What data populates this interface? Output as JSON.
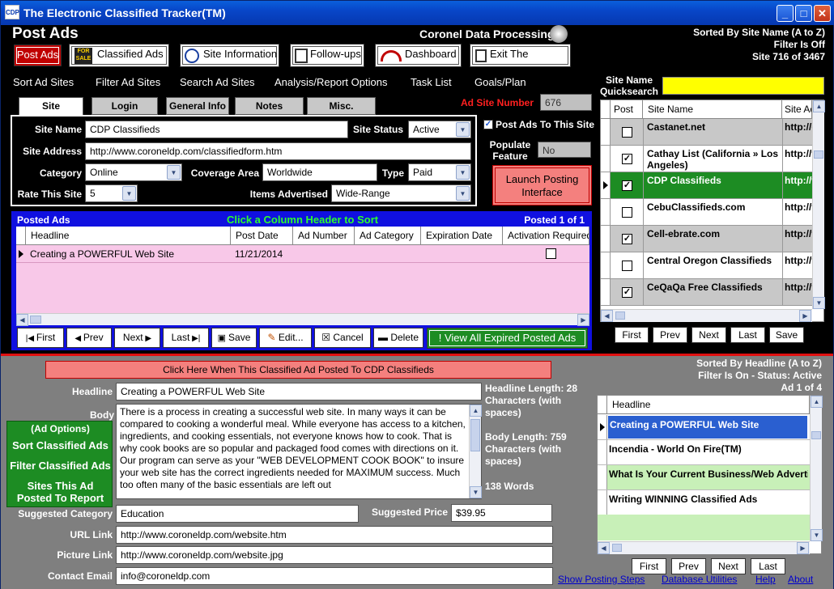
{
  "window": {
    "title": "The Electronic Classified Tracker(TM)",
    "icon_text": "CDP"
  },
  "header": {
    "title": "Post Ads",
    "company": "Coronel Data Processing",
    "sort_info": "Sorted By Site Name (A to Z)",
    "filter_info": "Filter Is Off",
    "record_info": "Site 716 of 3467"
  },
  "toolbar": {
    "post_ads": "Post Ads",
    "classified_ads": "Classified Ads",
    "site_information": "Site Information",
    "follow_ups": "Follow-ups",
    "dashboard": "Dashboard",
    "exit": "Exit The Program",
    "forsale_icon_text": "FOR SALE"
  },
  "menu": [
    "Sort Ad Sites",
    "Filter Ad Sites",
    "Search Ad Sites",
    "Analysis/Report Options",
    "Task List",
    "Goals/Plan"
  ],
  "tabs": [
    "Site",
    "Login",
    "General Info",
    "Notes",
    "Misc."
  ],
  "ad_site_number": {
    "label": "Ad Site Number",
    "value": "676"
  },
  "site": {
    "site_name_label": "Site Name",
    "site_name": "CDP Classifieds",
    "site_status_label": "Site Status",
    "site_status": "Active",
    "site_address_label": "Site Address",
    "site_address": "http://www.coroneldp.com/classifiedform.htm",
    "category_label": "Category",
    "category": "Online",
    "coverage_label": "Coverage Area",
    "coverage": "Worldwide",
    "type_label": "Type",
    "type": "Paid",
    "rate_label": "Rate This Site",
    "rate": "5",
    "items_label": "Items Advertised",
    "items": "Wide-Range",
    "post_ads_to_site": "Post Ads To This Site",
    "populate_label": "Populate Feature",
    "populate_value": "No",
    "launch": "Launch Posting Interface"
  },
  "posted_ads": {
    "title": "Posted Ads",
    "hint": "Click a Column Header to Sort",
    "count": "Posted 1 of 1",
    "columns": [
      "Headline",
      "Post Date",
      "Ad Number",
      "Ad Category",
      "Expiration Date",
      "Activation Required"
    ],
    "rows": [
      {
        "headline": "Creating a POWERFUL Web Site",
        "post_date": "11/21/2014",
        "ad_number": "",
        "ad_category": "",
        "expiration": "",
        "activation": false
      }
    ],
    "buttons": {
      "first": "First",
      "prev": "Prev",
      "next": "Next",
      "last": "Last",
      "save": "Save",
      "edit": "Edit...",
      "cancel": "Cancel",
      "delete": "Delete",
      "view_expired": "View All Expired Posted Ads"
    }
  },
  "site_list": {
    "quicksearch_label": "Site Name Quicksearch",
    "quicksearch_value": "",
    "columns": [
      "Post",
      "Site Name",
      "Site Ad"
    ],
    "rows": [
      {
        "post": false,
        "name": "Castanet.net",
        "addr": "http://c"
      },
      {
        "post": true,
        "name": "Cathay List (California » Los Angeles)",
        "addr": "http://v"
      },
      {
        "post": true,
        "name": "CDP Classifieds",
        "addr": "http://w"
      },
      {
        "post": false,
        "name": "CebuClassifieds.com",
        "addr": "http://v"
      },
      {
        "post": true,
        "name": "Cell-ebrate.com",
        "addr": "http://v"
      },
      {
        "post": false,
        "name": "Central Oregon Classifieds",
        "addr": "http://v"
      },
      {
        "post": true,
        "name": "CeQaQa Free Classifieds",
        "addr": "http://v"
      }
    ],
    "buttons": {
      "first": "First",
      "prev": "Prev",
      "next": "Next",
      "last": "Last",
      "save": "Save"
    }
  },
  "ad": {
    "posted_banner": "Click Here When This Classified Ad Posted To CDP Classifieds",
    "headline_label": "Headline",
    "headline": "Creating a POWERFUL Web Site",
    "body_label": "Body",
    "body": "There is a process in creating a successful web site.  In many ways it can be compared to cooking a wonderful meal.  While everyone has access to a kitchen, ingredients, and cooking essentials, not everyone knows how to cook.  That is why cook books are so popular and packaged food comes with directions on it. Our program can serve as your \"WEB DEVELOPMENT COOK BOOK\" to insure your web site has the correct ingredients needed for MAXIMUM success. Much too often many of the basic essentials are left out",
    "headline_length": "Headline Length: 28 Characters  (with spaces)",
    "body_length": "Body Length: 759 Characters  (with spaces)",
    "words": "138 Words",
    "ad_options_title": "(Ad Options)",
    "sort_ads": "Sort Classified Ads",
    "filter_ads": "Filter Classified Ads",
    "sites_report": "Sites This Ad Posted To Report",
    "suggested_category_label": "Suggested Category",
    "suggested_category": "Education",
    "suggested_price_label": "Suggested Price",
    "suggested_price": "$39.95",
    "url_label": "URL Link",
    "url": "http://www.coroneldp.com/website.htm",
    "picture_label": "Picture Link",
    "picture": "http://www.coroneldp.com/website.jpg",
    "email_label": "Contact Email",
    "email": "info@coroneldp.com"
  },
  "headline_list": {
    "sort_info": "Sorted By Headline (A to Z)",
    "filter_info": "Filter Is On - Status: Active",
    "record_info": "Ad 1 of 4",
    "column": "Headline",
    "rows": [
      "Creating a POWERFUL Web Site",
      "Incendia - World On Fire(TM)",
      "What Is Your Current Business/Web Adverti",
      "Writing WINNING Classified Ads"
    ],
    "buttons": {
      "first": "First",
      "prev": "Prev",
      "next": "Next",
      "last": "Last"
    }
  },
  "footer": {
    "show_steps": "Show Posting Steps",
    "db_utils": "Database Utilities",
    "help": "Help",
    "about": "About"
  },
  "colors": {
    "accent": "#c00000",
    "selected": "#1d8c23",
    "titlebar": "#0846c8",
    "pink": "#f8c8e8",
    "yellow": "#ffff00",
    "green_row": "#c8f0b8"
  }
}
